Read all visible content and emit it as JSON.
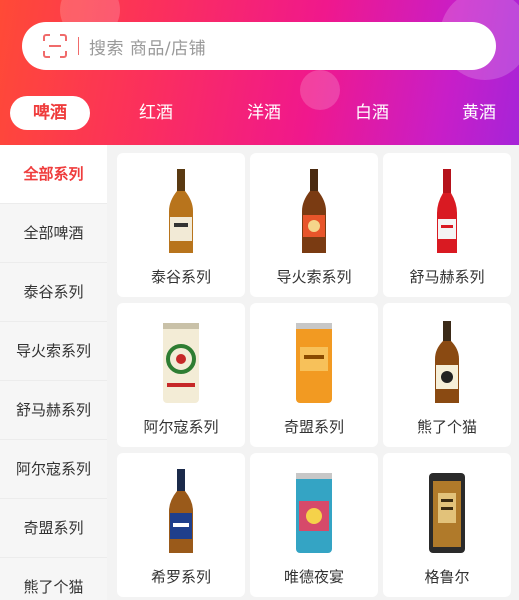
{
  "search": {
    "placeholder": "搜索 商品/店铺"
  },
  "tabs": [
    "啤酒",
    "红酒",
    "洋酒",
    "白酒",
    "黄酒"
  ],
  "sidebar": [
    "全部系列",
    "全部啤酒",
    "泰谷系列",
    "导火索系列",
    "舒马赫系列",
    "阿尔寇系列",
    "奇盟系列",
    "熊了个猫"
  ],
  "products": [
    {
      "name": "泰谷系列",
      "icon": "amber-bottle-icon"
    },
    {
      "name": "导火索系列",
      "icon": "brown-bottle-icon"
    },
    {
      "name": "舒马赫系列",
      "icon": "red-bottle-icon"
    },
    {
      "name": "阿尔寇系列",
      "icon": "wreath-can-icon"
    },
    {
      "name": "奇盟系列",
      "icon": "orange-can-icon"
    },
    {
      "name": "熊了个猫",
      "icon": "stubby-bottle-icon"
    },
    {
      "name": "希罗系列",
      "icon": "blue-label-bottle-icon"
    },
    {
      "name": "唯德夜宴",
      "icon": "cyan-can-icon"
    },
    {
      "name": "格鲁尔",
      "icon": "gold-can-icon"
    }
  ],
  "colors": {
    "accent": "#ef3d3d",
    "header_start": "#ff4a36",
    "header_end": "#a624d8"
  }
}
